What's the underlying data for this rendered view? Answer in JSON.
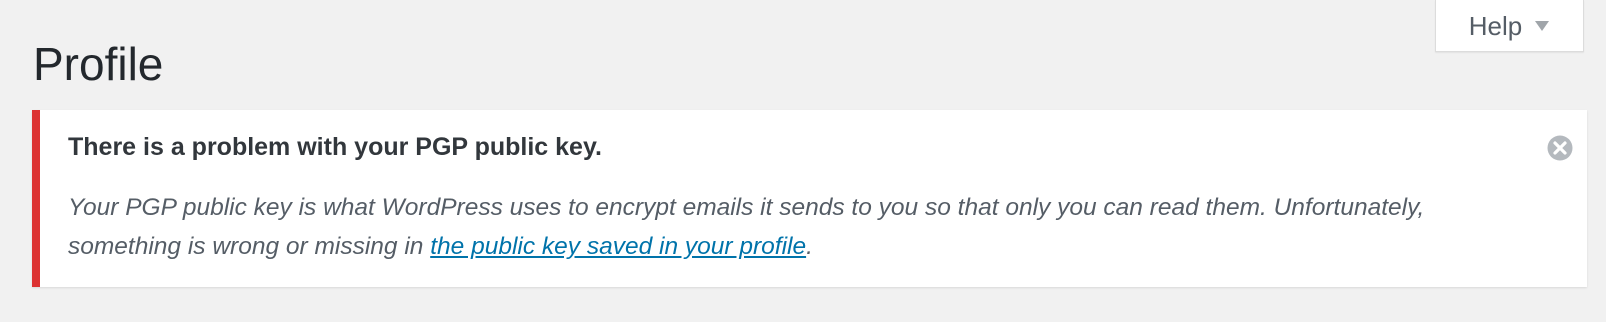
{
  "screen": {
    "title": "Profile"
  },
  "help_tab": {
    "label": "Help"
  },
  "notice": {
    "title": "There is a problem with your PGP public key.",
    "body_before_link": "Your PGP public key is what WordPress uses to encrypt emails it sends to you so that only you can read them. Unfortunately, something is wrong or missing in ",
    "link_text": "the public key saved in your profile",
    "body_after_link": ".",
    "dismiss_icon": "close-circle-icon"
  },
  "colors": {
    "page_background": "#f1f1f1",
    "notice_error_border": "#dc3232",
    "link": "#0073aa",
    "text": "#23282d",
    "muted_text": "#555d66"
  }
}
